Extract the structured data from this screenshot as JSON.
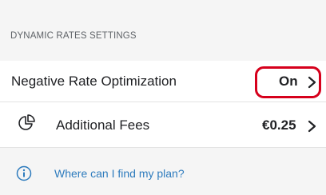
{
  "section": {
    "title": "DYNAMIC RATES SETTINGS"
  },
  "rows": [
    {
      "label": "Negative Rate Optimization",
      "value": "On",
      "icon": "chevron-right-icon"
    },
    {
      "label": "Additional Fees",
      "value": "€0.25",
      "icon": "pie-chart-icon"
    }
  ],
  "help": {
    "text": "Where can I find my plan?",
    "icon": "info-icon"
  },
  "colors": {
    "highlight": "#d6001c",
    "link": "#2d7bbd",
    "background": "#f5f5f5",
    "card": "#ffffff"
  }
}
